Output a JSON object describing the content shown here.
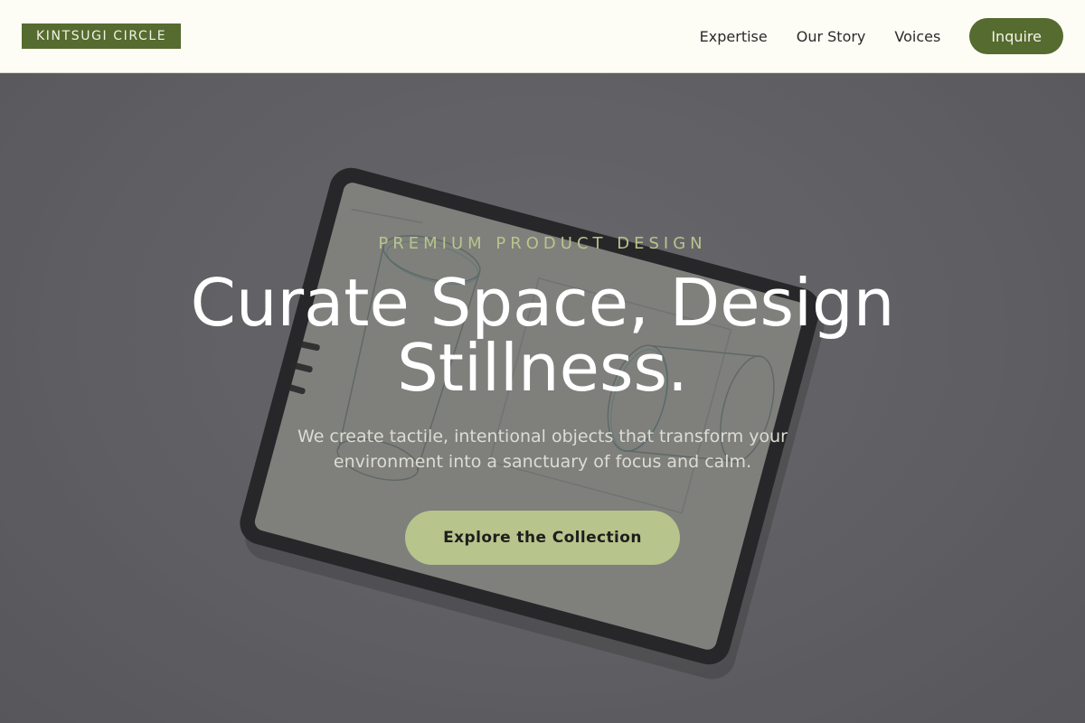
{
  "header": {
    "logo": "KINTSUGI CIRCLE",
    "nav": [
      {
        "label": "Expertise"
      },
      {
        "label": "Our Story"
      },
      {
        "label": "Voices"
      }
    ],
    "cta_label": "Inquire"
  },
  "hero": {
    "eyebrow": "PREMIUM PRODUCT DESIGN",
    "headline": "Curate Space, Design Stillness.",
    "subtext": "We create tactile, intentional objects that transform your environment into a sanctuary of focus and calm.",
    "cta_label": "Explore the Collection",
    "background_image": "tablet-sketch-photo"
  },
  "colors": {
    "brand_green": "#556b2f",
    "accent_sage": "#b7c48b",
    "header_bg": "#fdfdf5"
  }
}
